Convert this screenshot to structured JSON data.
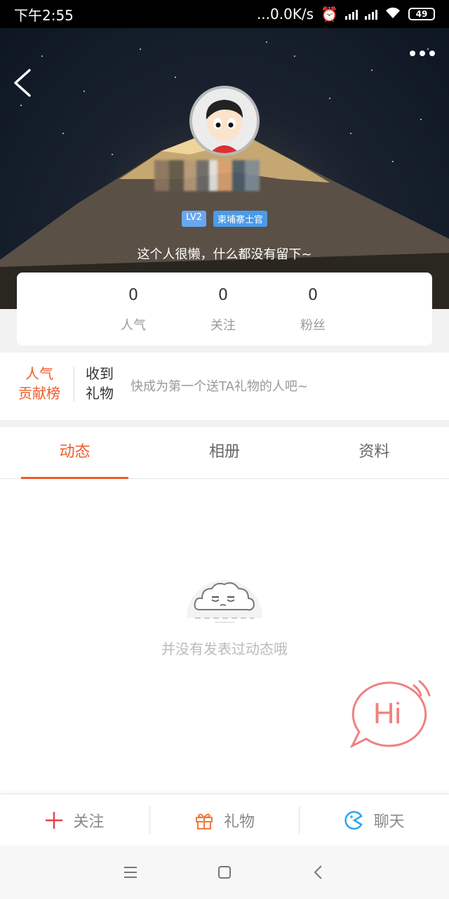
{
  "status_bar": {
    "time": "下午2:55",
    "network_speed": "...0.0K/s",
    "battery": "49"
  },
  "profile": {
    "level_badge": "LV2",
    "title_badge": "柬埔寨士官",
    "signature": "这个人很懒，什么都没有留下~"
  },
  "stats": [
    {
      "value": "0",
      "label": "人气"
    },
    {
      "value": "0",
      "label": "关注"
    },
    {
      "value": "0",
      "label": "粉丝"
    }
  ],
  "gifts": {
    "rank_line1": "人气",
    "rank_line2": "贡献榜",
    "received_line1": "收到",
    "received_line2": "礼物",
    "hint": "快成为第一个送TA礼物的人吧~"
  },
  "tabs": [
    {
      "label": "动态",
      "active": true
    },
    {
      "label": "相册",
      "active": false
    },
    {
      "label": "资料",
      "active": false
    }
  ],
  "empty_state": {
    "text": "并没有发表过动态哦"
  },
  "hi_bubble": {
    "text": "Hi"
  },
  "actions": [
    {
      "label": "关注",
      "icon": "plus-icon"
    },
    {
      "label": "礼物",
      "icon": "gift-icon"
    },
    {
      "label": "聊天",
      "icon": "chat-icon"
    }
  ],
  "colors": {
    "accent": "#f05a28",
    "badge_blue": "#4a9be8",
    "hi_pink": "#f08080"
  }
}
